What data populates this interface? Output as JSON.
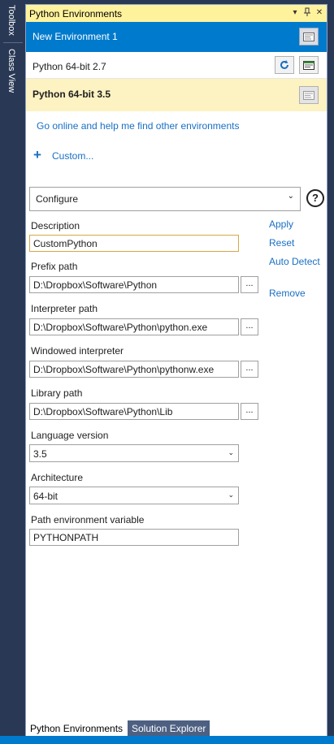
{
  "side_tabs": {
    "toolbox": "Toolbox",
    "class_view": "Class View"
  },
  "window": {
    "title": "Python Environments",
    "dropdown_glyph": "▾",
    "pin_glyph": "⊥",
    "close_glyph": "✕"
  },
  "environments": [
    {
      "label": "New Environment 1",
      "state": "selected"
    },
    {
      "label": "Python 64-bit 2.7",
      "state": "normal"
    },
    {
      "label": "Python 64-bit 3.5",
      "state": "highlighted"
    }
  ],
  "links": {
    "find_online": "Go online and help me find other environments",
    "custom": "Custom...",
    "plus_glyph": "+"
  },
  "configure": {
    "selected": "Configure",
    "chevron": "⌄",
    "help": "?"
  },
  "form": {
    "description": {
      "label": "Description",
      "value": "CustomPython"
    },
    "prefix_path": {
      "label": "Prefix path",
      "value": "D:\\Dropbox\\Software\\Python"
    },
    "interpreter_path": {
      "label": "Interpreter path",
      "value": "D:\\Dropbox\\Software\\Python\\python.exe"
    },
    "windowed_interpreter": {
      "label": "Windowed interpreter",
      "value": "D:\\Dropbox\\Software\\Python\\pythonw.exe"
    },
    "library_path": {
      "label": "Library path",
      "value": "D:\\Dropbox\\Software\\Python\\Lib"
    },
    "language_version": {
      "label": "Language version",
      "value": "3.5"
    },
    "architecture": {
      "label": "Architecture",
      "value": "64-bit"
    },
    "path_env_var": {
      "label": "Path environment variable",
      "value": "PYTHONPATH"
    },
    "browse_glyph": "...",
    "chevron": "⌄"
  },
  "actions": {
    "apply": "Apply",
    "reset": "Reset",
    "auto_detect": "Auto Detect",
    "remove": "Remove"
  },
  "bottom_tabs": {
    "active": "Python Environments",
    "inactive": "Solution Explorer"
  },
  "colors": {
    "accent": "#007acc",
    "title_bar": "#fff29d",
    "highlight_row": "#fdf2c2",
    "link": "#1a6fc4",
    "frame": "#293955"
  }
}
